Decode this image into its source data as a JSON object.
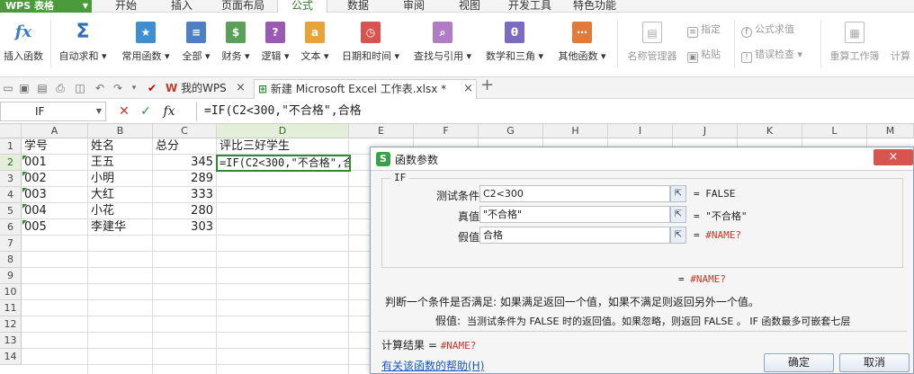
{
  "app": {
    "name": "WPS 表格"
  },
  "menu_tabs": [
    "开始",
    "插入",
    "页面布局",
    "公式",
    "数据",
    "审阅",
    "视图",
    "开发工具",
    "特色功能"
  ],
  "ribbon": {
    "buttons": [
      {
        "label": "插入函数",
        "icon": "fx-icon",
        "glyph": "fx"
      },
      {
        "label": "自动求和",
        "icon": "sigma-icon",
        "glyph": "Σ"
      },
      {
        "label": "常用函数",
        "icon": "star-book-icon",
        "glyph": "★"
      },
      {
        "label": "全部",
        "icon": "list-book-icon",
        "glyph": "≡"
      },
      {
        "label": "财务",
        "icon": "finance-icon",
        "glyph": "$"
      },
      {
        "label": "逻辑",
        "icon": "logic-icon",
        "glyph": "?"
      },
      {
        "label": "文本",
        "icon": "text-icon",
        "glyph": "a"
      },
      {
        "label": "日期和时间",
        "icon": "clock-icon",
        "glyph": "◷"
      },
      {
        "label": "查找与引用",
        "icon": "lookup-icon",
        "glyph": "⌕"
      },
      {
        "label": "数学和三角",
        "icon": "math-icon",
        "glyph": "θ"
      },
      {
        "label": "其他函数",
        "icon": "more-functions-icon",
        "glyph": "⋯"
      },
      {
        "label": "名称管理器",
        "icon": "name-manager-icon",
        "glyph": "▤"
      },
      {
        "label": "重算工作簿",
        "icon": "recalc-icon",
        "glyph": "▦"
      },
      {
        "label": "计算",
        "icon": "calc-icon",
        "glyph": ""
      }
    ],
    "small": [
      {
        "label": "指定"
      },
      {
        "label": "粘贴"
      },
      {
        "label": "公式求值"
      },
      {
        "label": "错误检查"
      }
    ]
  },
  "doc_tabs": [
    {
      "label": "我的WPS"
    },
    {
      "label": "新建 Microsoft Excel 工作表.xlsx *"
    }
  ],
  "formula_bar": {
    "name_box": "IF",
    "fx": "fx",
    "formula": "=IF(C2<300,\"不合格\",合格"
  },
  "sheet": {
    "columns": [
      "A",
      "B",
      "C",
      "D",
      "E",
      "F",
      "G",
      "H",
      "I",
      "J",
      "K",
      "L",
      "M"
    ],
    "rows": [
      "1",
      "2",
      "3",
      "4",
      "5",
      "6",
      "7",
      "8",
      "9",
      "10",
      "11",
      "12",
      "13",
      "14"
    ],
    "header": [
      "学号",
      "姓名",
      "总分",
      "评比三好学生"
    ],
    "data": [
      {
        "id": "001",
        "name": "王五",
        "score": "345"
      },
      {
        "id": "002",
        "name": "小明",
        "score": "289"
      },
      {
        "id": "003",
        "name": "大红",
        "score": "333"
      },
      {
        "id": "004",
        "name": "小花",
        "score": "280"
      },
      {
        "id": "005",
        "name": "李建华",
        "score": "303"
      }
    ],
    "active_cell_text": "=IF(C2<300,\"不合格\",合"
  },
  "dialog": {
    "title": "函数参数",
    "close": "×",
    "function_name": "IF",
    "args": [
      {
        "label": "测试条件",
        "value": "C2<300",
        "result": "= FALSE"
      },
      {
        "label": "真值",
        "value": "\"不合格\"",
        "result": "= \"不合格\""
      },
      {
        "label": "假值",
        "value": "合格",
        "result_prefix": "= ",
        "result": "#NAME?"
      }
    ],
    "total_prefix": "= ",
    "total": "#NAME?",
    "description": "判断一个条件是否满足: 如果满足返回一个值，如果不满足则返回另外一个值。",
    "arg_help_label": "假值:",
    "arg_help": "当测试条件为 FALSE 时的返回值。如果忽略，则返回 FALSE 。 IF 函数最多可嵌套七层",
    "result_label": "计算结果 = ",
    "result_value": "#NAME?",
    "help_link": "有关该函数的帮助(H)",
    "ok": "确定",
    "cancel": "取消"
  },
  "colors": {
    "accent": "#2f8a2f",
    "error": "#c0392b",
    "link": "#1a55c0"
  }
}
